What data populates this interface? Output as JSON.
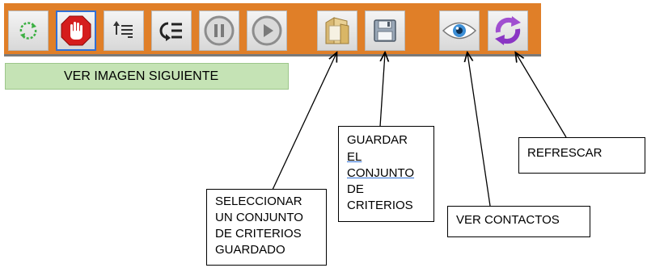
{
  "toolbar": {
    "buttons": [
      {
        "icon": "refresh-cycle-icon"
      },
      {
        "icon": "stop-hand-icon",
        "selected": true
      },
      {
        "icon": "sort-list-icon"
      },
      {
        "icon": "return-list-icon"
      },
      {
        "icon": "pause-icon"
      },
      {
        "icon": "play-icon"
      },
      {
        "icon": "folder-icon"
      },
      {
        "icon": "save-disk-icon"
      },
      {
        "icon": "eye-icon"
      },
      {
        "icon": "refresh-arrows-icon"
      }
    ]
  },
  "next_image_label": "VER IMAGEN SIGUIENTE",
  "callouts": {
    "select": [
      "SELECCIONAR",
      "UN CONJUNTO",
      "DE  CRITERIOS",
      "GUARDADO"
    ],
    "save": [
      "GUARDAR",
      "EL",
      "CONJUNTO",
      "DE",
      "CRITERIOS"
    ],
    "contacts": [
      "VER CONTACTOS"
    ],
    "refresh": [
      "REFRESCAR"
    ]
  },
  "colors": {
    "toolbar_bg": "#e07f28",
    "next_bar_bg": "#c5e3b5",
    "selected_border": "#2f6fd6"
  }
}
